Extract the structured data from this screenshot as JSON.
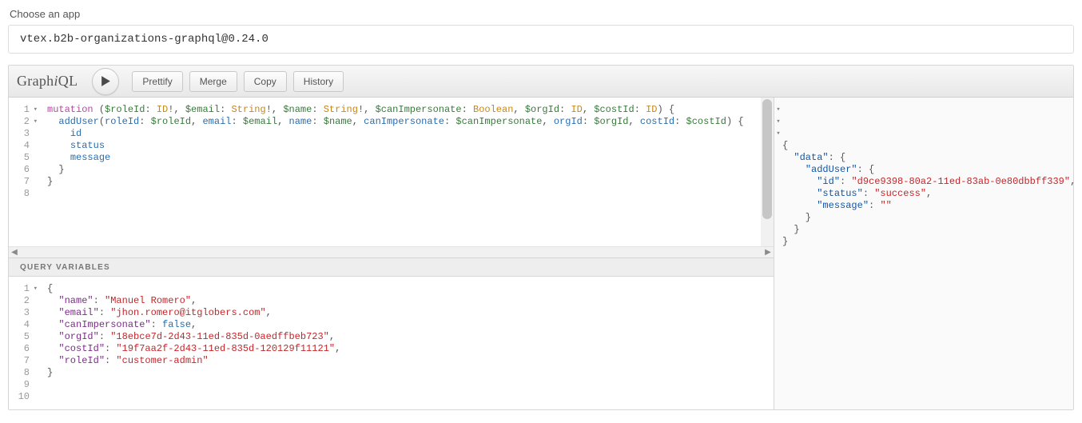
{
  "header": {
    "choose_label": "Choose an app",
    "app_value": "vtex.b2b-organizations-graphql@0.24.0"
  },
  "toolbar": {
    "logo_plain_prefix": "Graph",
    "logo_italic": "i",
    "logo_plain_suffix": "QL",
    "prettify": "Prettify",
    "merge": "Merge",
    "copy": "Copy",
    "history": "History"
  },
  "query_editor": {
    "line_numbers": [
      "1",
      "2",
      "3",
      "4",
      "5",
      "6",
      "7",
      "8"
    ],
    "fold_lines": [
      1,
      2
    ],
    "tokens": [
      [
        {
          "t": "mutation ",
          "c": "kw"
        },
        {
          "t": "(",
          "c": "punc"
        },
        {
          "t": "$roleId",
          "c": "var"
        },
        {
          "t": ": ",
          "c": "punc"
        },
        {
          "t": "ID",
          "c": "type"
        },
        {
          "t": "!, ",
          "c": "punc"
        },
        {
          "t": "$email",
          "c": "var"
        },
        {
          "t": ": ",
          "c": "punc"
        },
        {
          "t": "String",
          "c": "type"
        },
        {
          "t": "!, ",
          "c": "punc"
        },
        {
          "t": "$name",
          "c": "var"
        },
        {
          "t": ": ",
          "c": "punc"
        },
        {
          "t": "String",
          "c": "type"
        },
        {
          "t": "!, ",
          "c": "punc"
        },
        {
          "t": "$canImpersonate",
          "c": "var"
        },
        {
          "t": ": ",
          "c": "punc"
        },
        {
          "t": "Boolean",
          "c": "type"
        },
        {
          "t": ", ",
          "c": "punc"
        },
        {
          "t": "$orgId",
          "c": "var"
        },
        {
          "t": ": ",
          "c": "punc"
        },
        {
          "t": "ID",
          "c": "type"
        },
        {
          "t": ", ",
          "c": "punc"
        },
        {
          "t": "$costId",
          "c": "var"
        },
        {
          "t": ": ",
          "c": "punc"
        },
        {
          "t": "ID",
          "c": "type"
        },
        {
          "t": ") {",
          "c": "punc"
        }
      ],
      [
        {
          "t": "  ",
          "c": "punc"
        },
        {
          "t": "addUser",
          "c": "field"
        },
        {
          "t": "(",
          "c": "punc"
        },
        {
          "t": "roleId",
          "c": "field"
        },
        {
          "t": ": ",
          "c": "punc"
        },
        {
          "t": "$roleId",
          "c": "var"
        },
        {
          "t": ", ",
          "c": "punc"
        },
        {
          "t": "email",
          "c": "field"
        },
        {
          "t": ": ",
          "c": "punc"
        },
        {
          "t": "$email",
          "c": "var"
        },
        {
          "t": ", ",
          "c": "punc"
        },
        {
          "t": "name",
          "c": "field"
        },
        {
          "t": ": ",
          "c": "punc"
        },
        {
          "t": "$name",
          "c": "var"
        },
        {
          "t": ", ",
          "c": "punc"
        },
        {
          "t": "canImpersonate",
          "c": "field"
        },
        {
          "t": ": ",
          "c": "punc"
        },
        {
          "t": "$canImpersonate",
          "c": "var"
        },
        {
          "t": ", ",
          "c": "punc"
        },
        {
          "t": "orgId",
          "c": "field"
        },
        {
          "t": ": ",
          "c": "punc"
        },
        {
          "t": "$orgId",
          "c": "var"
        },
        {
          "t": ", ",
          "c": "punc"
        },
        {
          "t": "costId",
          "c": "field"
        },
        {
          "t": ": ",
          "c": "punc"
        },
        {
          "t": "$costId",
          "c": "var"
        },
        {
          "t": ") {",
          "c": "punc"
        }
      ],
      [
        {
          "t": "    ",
          "c": "punc"
        },
        {
          "t": "id",
          "c": "field"
        }
      ],
      [
        {
          "t": "    ",
          "c": "punc"
        },
        {
          "t": "status",
          "c": "field"
        }
      ],
      [
        {
          "t": "    ",
          "c": "punc"
        },
        {
          "t": "message",
          "c": "field"
        }
      ],
      [
        {
          "t": "  }",
          "c": "punc"
        }
      ],
      [
        {
          "t": "}",
          "c": "punc"
        }
      ],
      []
    ]
  },
  "query_variables": {
    "header": "Query Variables",
    "line_numbers": [
      "1",
      "2",
      "3",
      "4",
      "5",
      "6",
      "7",
      "8",
      "9",
      "10"
    ],
    "fold_lines": [
      1
    ],
    "tokens": [
      [
        {
          "t": "{",
          "c": "punc"
        }
      ],
      [
        {
          "t": "  ",
          "c": "punc"
        },
        {
          "t": "\"name\"",
          "c": "propq"
        },
        {
          "t": ": ",
          "c": "punc"
        },
        {
          "t": "\"Manuel Romero\"",
          "c": "str"
        },
        {
          "t": ",",
          "c": "punc"
        }
      ],
      [
        {
          "t": "  ",
          "c": "punc"
        },
        {
          "t": "\"email\"",
          "c": "propq"
        },
        {
          "t": ": ",
          "c": "punc"
        },
        {
          "t": "\"jhon.romero@itglobers.com\"",
          "c": "str"
        },
        {
          "t": ",",
          "c": "punc"
        }
      ],
      [
        {
          "t": "  ",
          "c": "punc"
        },
        {
          "t": "\"canImpersonate\"",
          "c": "propq"
        },
        {
          "t": ": ",
          "c": "punc"
        },
        {
          "t": "false",
          "c": "bool"
        },
        {
          "t": ",",
          "c": "punc"
        }
      ],
      [
        {
          "t": "  ",
          "c": "punc"
        },
        {
          "t": "\"orgId\"",
          "c": "propq"
        },
        {
          "t": ": ",
          "c": "punc"
        },
        {
          "t": "\"18ebce7d-2d43-11ed-835d-0aedffbeb723\"",
          "c": "str"
        },
        {
          "t": ",",
          "c": "punc"
        }
      ],
      [
        {
          "t": "  ",
          "c": "punc"
        },
        {
          "t": "\"costId\"",
          "c": "propq"
        },
        {
          "t": ": ",
          "c": "punc"
        },
        {
          "t": "\"19f7aa2f-2d43-11ed-835d-120129f11121\"",
          "c": "str"
        },
        {
          "t": ",",
          "c": "punc"
        }
      ],
      [
        {
          "t": "  ",
          "c": "punc"
        },
        {
          "t": "\"roleId\"",
          "c": "propq"
        },
        {
          "t": ": ",
          "c": "punc"
        },
        {
          "t": "\"customer-admin\"",
          "c": "str"
        }
      ],
      [
        {
          "t": "}",
          "c": "punc"
        }
      ],
      [],
      []
    ]
  },
  "result": {
    "fold_lines": [
      1,
      2,
      3
    ],
    "tokens": [
      [
        {
          "t": "{",
          "c": "punc"
        }
      ],
      [
        {
          "t": "  ",
          "c": "punc"
        },
        {
          "t": "\"data\"",
          "c": "propr"
        },
        {
          "t": ": {",
          "c": "punc"
        }
      ],
      [
        {
          "t": "    ",
          "c": "punc"
        },
        {
          "t": "\"addUser\"",
          "c": "propr"
        },
        {
          "t": ": {",
          "c": "punc"
        }
      ],
      [
        {
          "t": "      ",
          "c": "punc"
        },
        {
          "t": "\"id\"",
          "c": "propr"
        },
        {
          "t": ": ",
          "c": "punc"
        },
        {
          "t": "\"d9ce9398-80a2-11ed-83ab-0e80dbbff339\"",
          "c": "str"
        },
        {
          "t": ",",
          "c": "punc"
        }
      ],
      [
        {
          "t": "      ",
          "c": "punc"
        },
        {
          "t": "\"status\"",
          "c": "propr"
        },
        {
          "t": ": ",
          "c": "punc"
        },
        {
          "t": "\"success\"",
          "c": "str"
        },
        {
          "t": ",",
          "c": "punc"
        }
      ],
      [
        {
          "t": "      ",
          "c": "punc"
        },
        {
          "t": "\"message\"",
          "c": "propr"
        },
        {
          "t": ": ",
          "c": "punc"
        },
        {
          "t": "\"\"",
          "c": "str"
        }
      ],
      [
        {
          "t": "    }",
          "c": "punc"
        }
      ],
      [
        {
          "t": "  }",
          "c": "punc"
        }
      ],
      [
        {
          "t": "}",
          "c": "punc"
        }
      ]
    ]
  }
}
